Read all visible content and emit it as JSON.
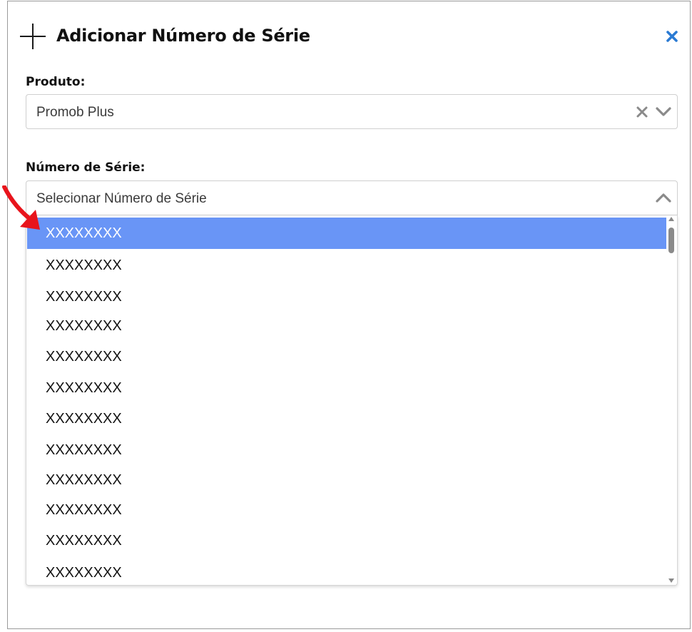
{
  "dialog": {
    "title": "Adicionar Número de Série",
    "icon": "plus-icon",
    "close_icon": "close-icon",
    "accent_color": "#2b7bd3"
  },
  "produto": {
    "label": "Produto:",
    "value": "Promob Plus",
    "clear_icon": "clear-icon",
    "toggle_icon": "chevron-down-icon"
  },
  "serie": {
    "label": "Número de Série:",
    "placeholder": "Selecionar Número de Série",
    "toggle_icon": "chevron-up-icon",
    "highlight_color": "#6995f6",
    "options": [
      "XXXXXXXX",
      "XXXXXXXX",
      "XXXXXXXX",
      "XXXXXXXX",
      "XXXXXXXX",
      "XXXXXXXX",
      "XXXXXXXX",
      "XXXXXXXX",
      "XXXXXXXX",
      "XXXXXXXX",
      "XXXXXXXX",
      "XXXXXXXX"
    ],
    "selected_index": 0
  },
  "annotation": {
    "icon": "red-arrow-icon",
    "color": "#e8141c"
  }
}
